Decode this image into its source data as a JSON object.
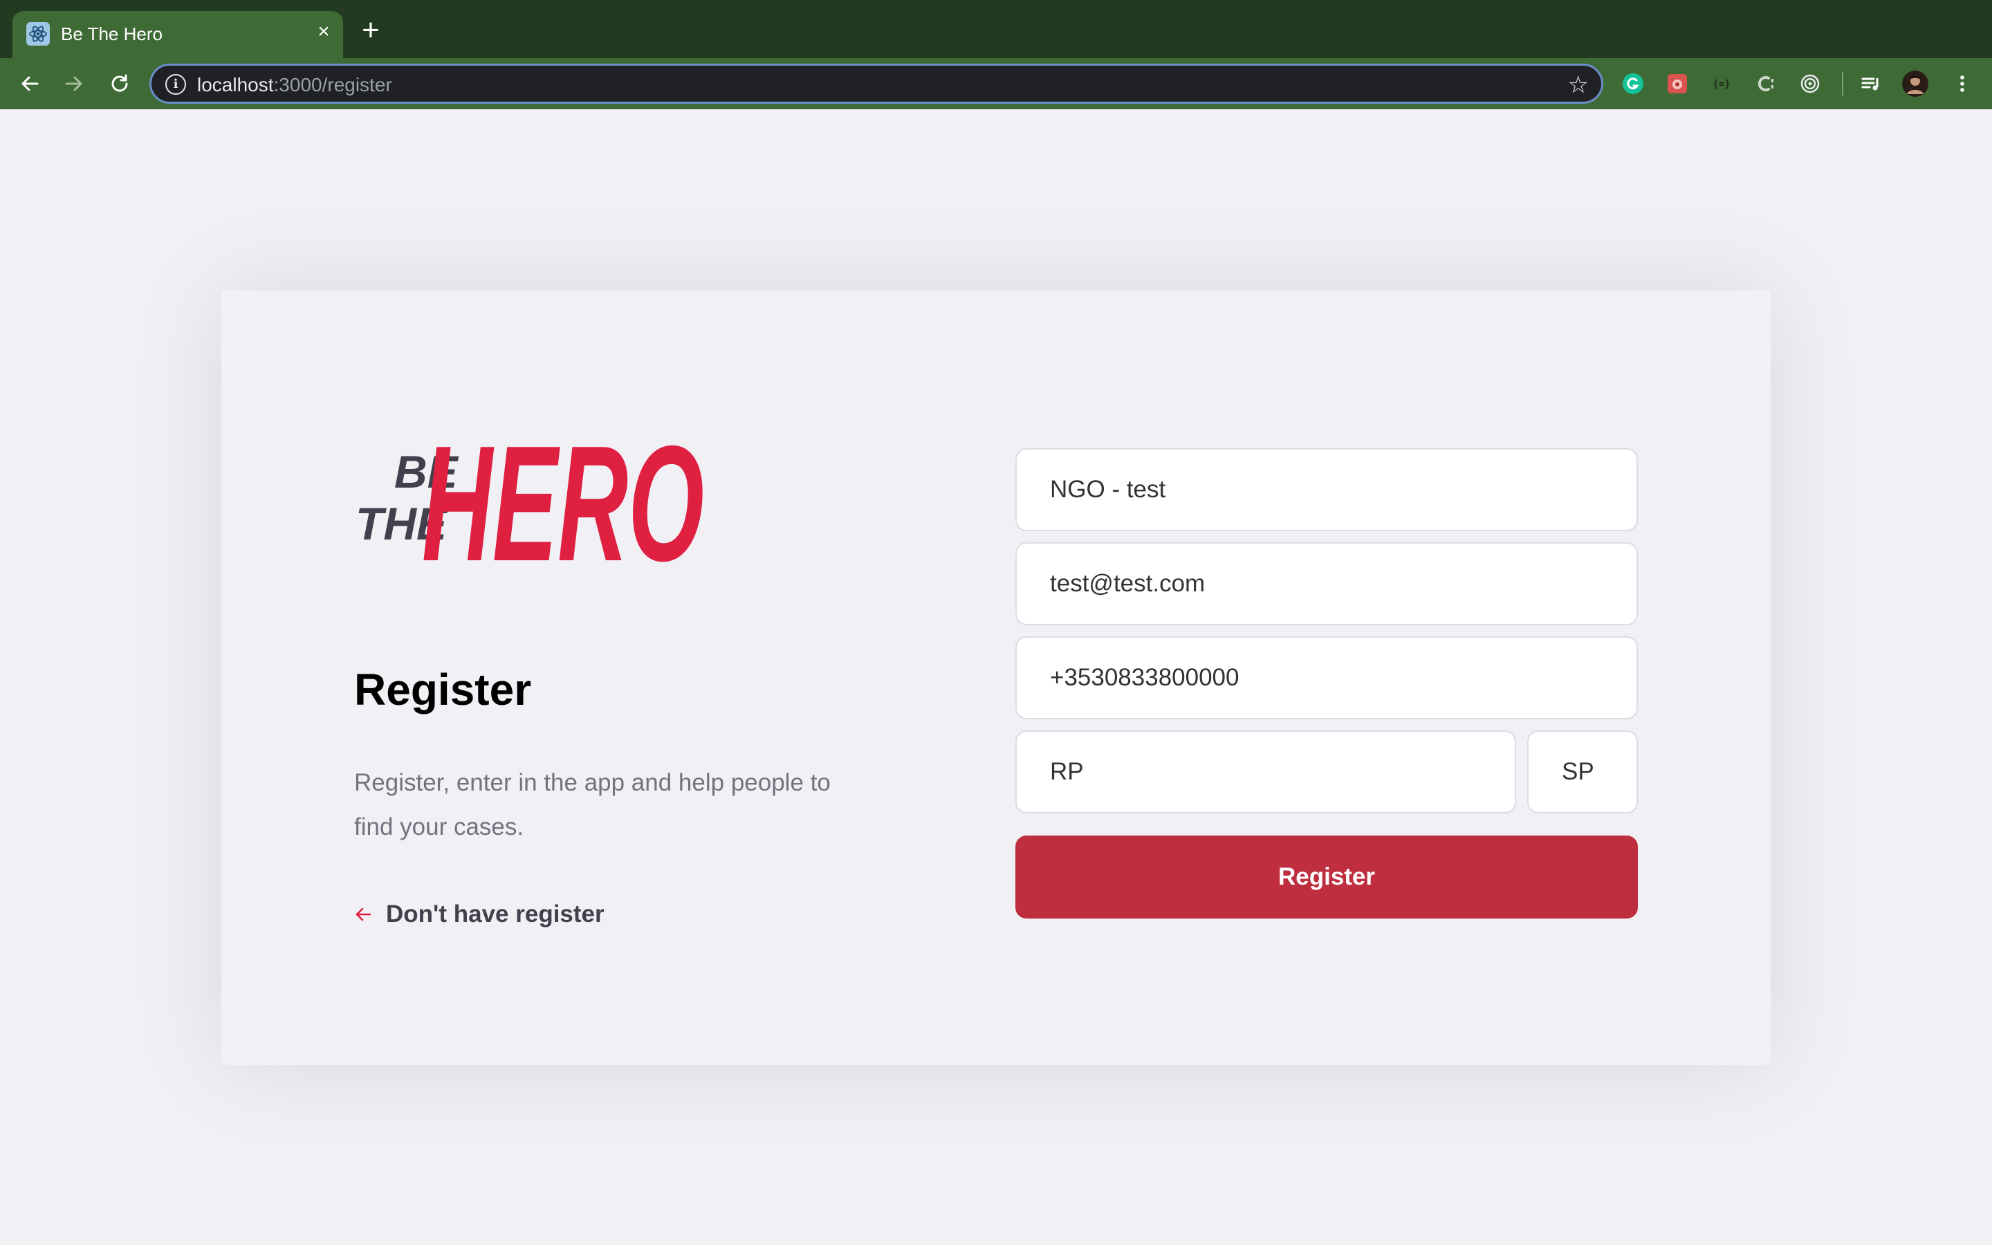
{
  "browser": {
    "tab_title": "Be The Hero",
    "tab_close": "×",
    "new_tab": "+",
    "url_host": "localhost",
    "url_rest": ":3000/register",
    "info_glyph": "i",
    "star_glyph": "☆"
  },
  "logo": {
    "line1": "BE",
    "line2": "THE",
    "word": "HERO",
    "dark_color": "#41414d",
    "brand_color": "#e02041"
  },
  "page": {
    "heading": "Register",
    "description": "Register, enter in the app and help people to find your cases.",
    "back_link": "Don't have register"
  },
  "form": {
    "name_value": "NGO - test",
    "email_value": "test@test.com",
    "whatsapp_value": "+3530833800000",
    "city_value": "RP",
    "uf_value": "SP",
    "submit_label": "Register"
  },
  "colors": {
    "accent": "#be2e3f",
    "arrow": "#e02041",
    "background": "#f0f0f5",
    "chrome_dark": "#213a20",
    "chrome_light": "#3e6a35"
  }
}
